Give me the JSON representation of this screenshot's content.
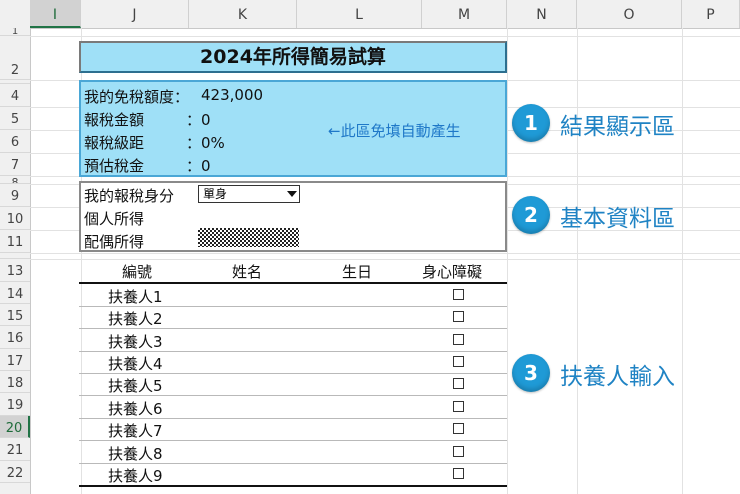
{
  "columns": [
    "I",
    "J",
    "K",
    "L",
    "M",
    "N",
    "O",
    "P"
  ],
  "rows": [
    "1",
    "2",
    "",
    "4",
    "5",
    "6",
    "7",
    "8",
    "9",
    "10",
    "11",
    "",
    "13",
    "14",
    "15",
    "16",
    "17",
    "18",
    "19",
    "20",
    "21",
    "22"
  ],
  "title": "2024年所得簡易試算",
  "result": {
    "exemption_label": "我的免稅額度：",
    "exemption_value": "423,000",
    "tax_amount_label": "報稅金額",
    "tax_amount_value": "：0",
    "bracket_label": "報稅級距",
    "bracket_value": "：0%",
    "estimated_label": "預估稅金",
    "estimated_value": "：0",
    "auto_note": "←此區免填自動產生"
  },
  "basic": {
    "status_label": "我的報稅身分",
    "status_value": "單身",
    "personal_income_label": "個人所得",
    "spouse_income_label": "配偶所得"
  },
  "dependents": {
    "headers": [
      "編號",
      "姓名",
      "生日",
      "身心障礙"
    ],
    "names": [
      "扶養人1",
      "扶養人2",
      "扶養人3",
      "扶養人4",
      "扶養人5",
      "扶養人6",
      "扶養人7",
      "扶養人8",
      "扶養人9"
    ]
  },
  "sections": [
    {
      "number": "1",
      "label": "結果顯示區"
    },
    {
      "number": "2",
      "label": "基本資料區"
    },
    {
      "number": "3",
      "label": "扶養人輸入"
    }
  ]
}
